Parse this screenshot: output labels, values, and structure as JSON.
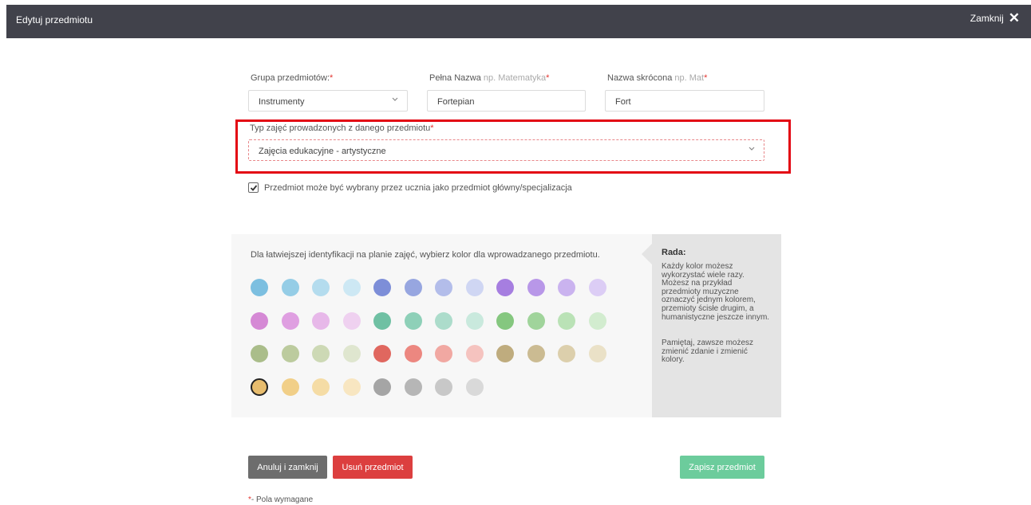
{
  "header": {
    "title": "Edytuj przedmiotu",
    "close_label": "Zamknij"
  },
  "form": {
    "group": {
      "label": "Grupa przedmiotów:",
      "required_mark": "*",
      "value": "Instrumenty"
    },
    "full_name": {
      "label": "Pełna Nazwa",
      "hint": "np. Matematyka",
      "required_mark": "*",
      "value": "Fortepian"
    },
    "short_name": {
      "label": "Nazwa skrócona",
      "hint": "np. Mat",
      "required_mark": "*",
      "value": "Fort"
    },
    "class_type": {
      "label": "Typ zajęć prowadzonych z danego przedmiotu",
      "required_mark": "*",
      "value": "Zajęcia edukacyjne - artystyczne"
    },
    "main_subject_checkbox": {
      "checked": true,
      "label": "Przedmiot może być wybrany przez ucznia jako przedmiot główny/specjalizacja"
    }
  },
  "colors": {
    "instruction": "Dla łatwiejszej identyfikacji na planie zajęć, wybierz kolor dla wprowadzanego przedmiotu.",
    "selected_index": 36,
    "swatches": [
      "#7cbfe0",
      "#95cde6",
      "#b4dcee",
      "#cde8f4",
      "#7d8ed8",
      "#97a6e0",
      "#b3bdea",
      "#cfd6f3",
      "#a67ee0",
      "#b897e8",
      "#cab3ef",
      "#dccdf5",
      "#d589d5",
      "#df9fe1",
      "#e7b8e9",
      "#efd1f0",
      "#6fc0a3",
      "#8ed0b8",
      "#acdccb",
      "#c9e9dd",
      "#85c77f",
      "#a0d49b",
      "#bae2b6",
      "#d2eccf",
      "#aabd8a",
      "#bccb9e",
      "#cdd9b5",
      "#dfe6cf",
      "#e0675f",
      "#ec8780",
      "#f1a8a2",
      "#f5c3bf",
      "#bfac7e",
      "#cbbb92",
      "#dccfac",
      "#eae1c7",
      "#e8bd6e",
      "#f1cf88",
      "#f5dca5",
      "#f8e6c1",
      "#a5a5a5",
      "#b6b6b6",
      "#c8c8c8",
      "#d9d9d9"
    ]
  },
  "tip": {
    "title": "Rada:",
    "paragraph1": "Każdy kolor możesz wykorzystać wiele razy. Możesz na przykład przedmioty muzyczne oznaczyć jednym kolorem, przemioty ścisłe drugim, a humanistyczne jeszcze innym.",
    "paragraph2": "Pamiętaj, zawsze możesz zmienić zdanie i zmienić kolory."
  },
  "buttons": {
    "cancel": "Anuluj i zamknij",
    "delete": "Usuń przedmiot",
    "save": "Zapisz przedmiot"
  },
  "footnote": {
    "mark": "*",
    "text": "- Pola wymagane"
  },
  "theme": {
    "header_bg": "#41424b",
    "required_color": "#e3342f",
    "highlight_border": "#e30613",
    "delete_color": "#dc3f3f",
    "save_color": "#6ccc9c"
  }
}
